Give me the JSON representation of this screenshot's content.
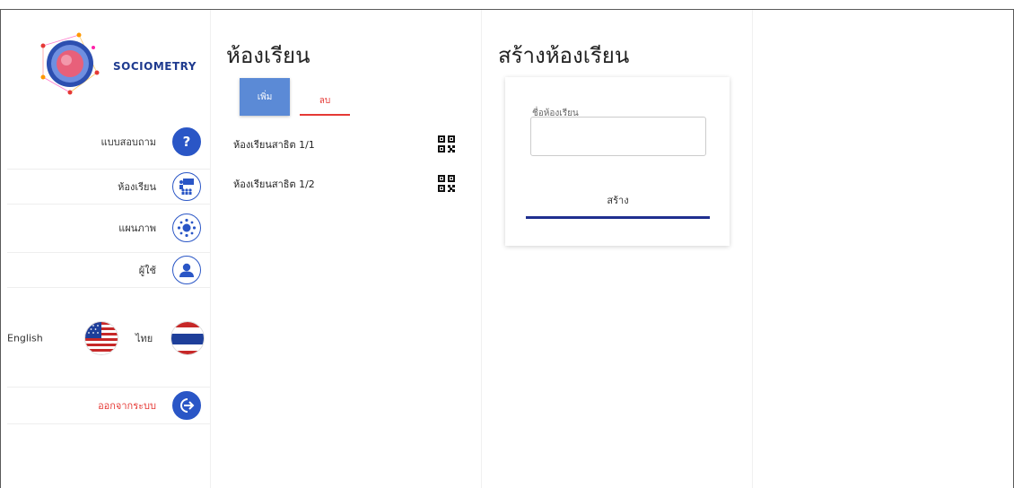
{
  "app": {
    "brand": "SOCIOMETRY"
  },
  "sidebar": {
    "items": [
      {
        "label": "แบบสอบถาม",
        "icon": "question-icon"
      },
      {
        "label": "ห้องเรียน",
        "icon": "classroom-icon"
      },
      {
        "label": "แผนภาพ",
        "icon": "network-diagram-icon"
      },
      {
        "label": "ผู้ใช้",
        "icon": "user-icon"
      }
    ],
    "languages": [
      {
        "label": "English",
        "icon": "us-flag-icon"
      },
      {
        "label": "ไทย",
        "icon": "thai-flag-icon"
      }
    ],
    "logout": {
      "label": "ออกจากระบบ",
      "icon": "logout-icon"
    }
  },
  "classrooms": {
    "title": "ห้องเรียน",
    "add_label": "เพิ่ม",
    "delete_label": "ลบ",
    "list": [
      {
        "name": "ห้องเรียนสาธิต 1/1",
        "icon": "qr-code-icon"
      },
      {
        "name": "ห้องเรียนสาธิต 1/2",
        "icon": "qr-code-icon"
      }
    ]
  },
  "create": {
    "title": "สร้างห้องเรียน",
    "field_label": "ชื่อห้องเรียน",
    "field_value": "",
    "submit_label": "สร้าง"
  },
  "colors": {
    "accent_blue": "#5b8ad6",
    "icon_blue": "#2a56c6",
    "danger_red": "#e53935",
    "dark_blue": "#1f2f8f"
  }
}
